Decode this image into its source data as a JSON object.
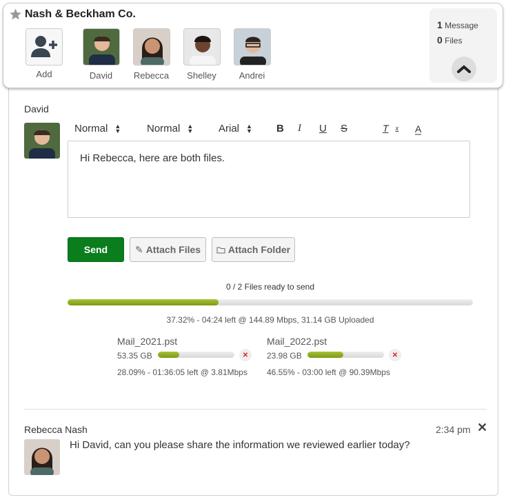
{
  "header": {
    "title": "Nash & Beckham Co.",
    "members": [
      {
        "name": "Add"
      },
      {
        "name": "David"
      },
      {
        "name": "Rebecca"
      },
      {
        "name": "Shelley"
      },
      {
        "name": "Andrei"
      }
    ],
    "message_count": "1",
    "message_label": "Message",
    "file_count": "0",
    "file_label": "Files"
  },
  "composer": {
    "author": "David",
    "toolbar": {
      "size": "Normal",
      "heading": "Normal",
      "font": "Arial"
    },
    "text": "Hi Rebecca, here are both files.",
    "send_label": "Send",
    "attach_files_label": "Attach Files",
    "attach_folder_label": "Attach Folder"
  },
  "upload": {
    "status": "0 / 2 Files ready to send",
    "progress_percent": 37.32,
    "summary": "37.32% - 04:24 left @ 144.89 Mbps, 31.14 GB Uploaded",
    "files": [
      {
        "name": "Mail_2021.pst",
        "size": "53.35 GB",
        "progress_percent": 28.09,
        "detail": "28.09% - 01:36:05 left @ 3.81Mbps"
      },
      {
        "name": "Mail_2022.pst",
        "size": "23.98 GB",
        "progress_percent": 46.55,
        "detail": "46.55% - 03:00 left @ 90.39Mbps"
      }
    ]
  },
  "message": {
    "author": "Rebecca Nash",
    "time": "2:34 pm",
    "text": "Hi David, can you please share the information we reviewed earlier today?"
  },
  "colors": {
    "send": "#0a7d1d",
    "progress": "#8eac22"
  }
}
